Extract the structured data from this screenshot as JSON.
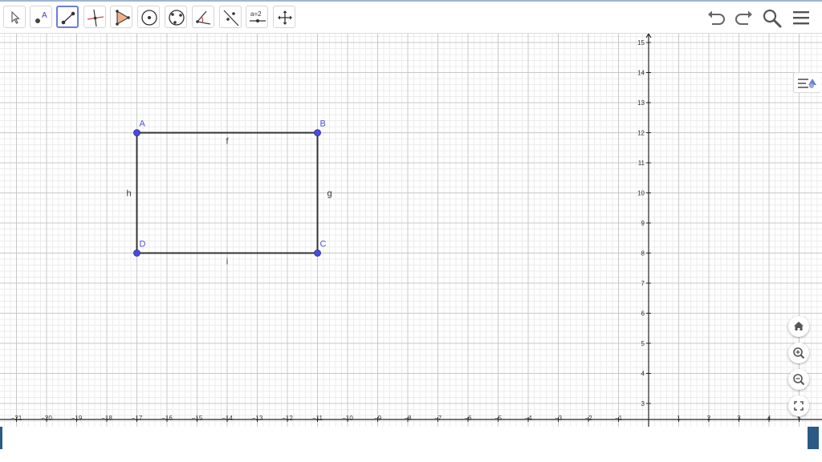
{
  "toolbar": {
    "tools": [
      {
        "name": "move-tool",
        "icon": "cursor-arrow-icon"
      },
      {
        "name": "point-tool",
        "icon": "point-icon",
        "glyph": "A"
      },
      {
        "name": "segment-tool",
        "icon": "segment-icon",
        "active": true
      },
      {
        "name": "perpendicular-line-tool",
        "icon": "perpendicular-icon"
      },
      {
        "name": "polygon-tool",
        "icon": "polygon-icon"
      },
      {
        "name": "circle-tool",
        "icon": "circle-center-point-icon"
      },
      {
        "name": "circle-three-points-tool",
        "icon": "circle-three-points-icon"
      },
      {
        "name": "angle-tool",
        "icon": "angle-icon"
      },
      {
        "name": "reflect-tool",
        "icon": "reflect-about-line-icon"
      },
      {
        "name": "slider-tool",
        "icon": "slider-icon",
        "glyph": "a=2"
      },
      {
        "name": "move-graphics-view-tool",
        "icon": "move-view-icon"
      }
    ],
    "right": [
      "undo-icon",
      "redo-icon",
      "search-icon",
      "menu-icon"
    ]
  },
  "graphics": {
    "x_ticks": [
      "−21",
      "−20",
      "−19",
      "−18",
      "−17",
      "−16",
      "−15",
      "−14",
      "−13",
      "−12",
      "−11",
      "−10",
      "−9",
      "−8",
      "−7",
      "−6",
      "−5",
      "−4",
      "−3",
      "−2",
      "−1",
      "1",
      "2",
      "3",
      "4",
      "5"
    ],
    "y_ticks": [
      "15",
      "14",
      "13",
      "12",
      "11",
      "10",
      "9",
      "8",
      "7",
      "6",
      "5",
      "4",
      "3"
    ],
    "points": [
      {
        "label": "A",
        "x": -17,
        "y": 12
      },
      {
        "label": "B",
        "x": -11,
        "y": 12
      },
      {
        "label": "C",
        "x": -11,
        "y": 8
      },
      {
        "label": "D",
        "x": -17,
        "y": 8
      }
    ],
    "segments": [
      {
        "label": "f",
        "from": "A",
        "to": "B"
      },
      {
        "label": "g",
        "from": "B",
        "to": "C"
      },
      {
        "label": "i",
        "from": "C",
        "to": "D"
      },
      {
        "label": "h",
        "from": "D",
        "to": "A"
      }
    ],
    "colors": {
      "point": "#4a4ae0",
      "segment": "#333333",
      "label": "#4d4dd8",
      "grid_major": "#c8c8c8",
      "grid_minor": "#ececec"
    }
  },
  "side_buttons": [
    "home-icon",
    "zoom-in-icon",
    "zoom-out-icon",
    "fullscreen-icon"
  ],
  "menu_toggle_icon": "algebra-view-toggle-icon"
}
